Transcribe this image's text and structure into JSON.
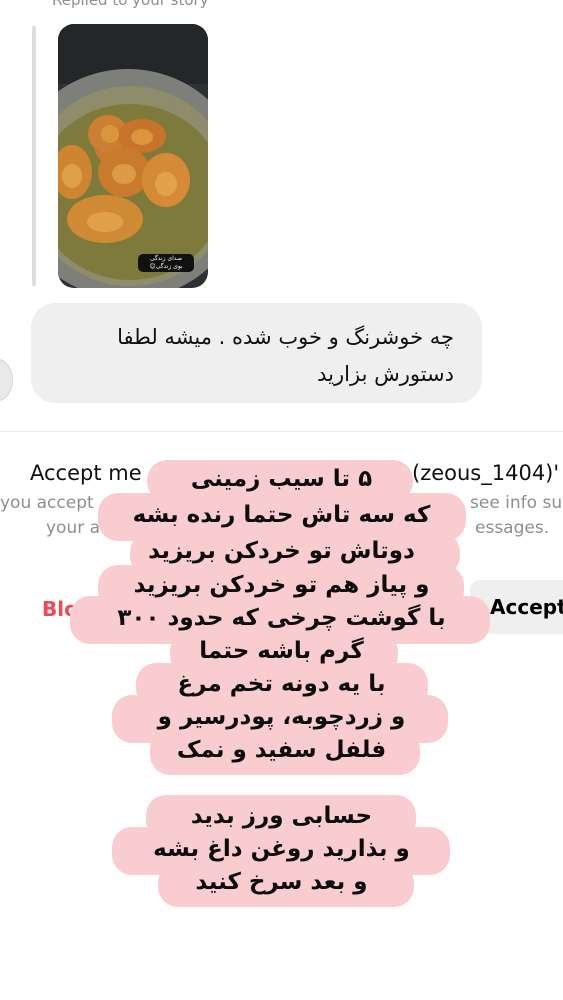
{
  "conversation": {
    "replied_label": "Replied to your story",
    "story_sticker": [
      "صدای زندگی",
      "بوی زندگی😊"
    ],
    "message": {
      "line1": "چه خوشرنگ و خوب شده . میشه لطفا",
      "line2": "دستورش بزارید"
    }
  },
  "request_panel": {
    "title_visible": "Accept me",
    "handle_visible": "(zeous_1404)'",
    "info_left_line1": "you accept",
    "info_left_line2": "your a",
    "info_right_line1": "see info su",
    "info_right_line2": "essages.",
    "block_label": "Blo",
    "accept_label": "Accept"
  },
  "recipe_overlay": {
    "colors": {
      "pill": "#f9cdd0",
      "text": "#0d0d0d"
    },
    "lines": [
      "۵ تا سیب زمینی",
      "که سه تاش حتما رنده بشه",
      "دوتاش تو خردکن بریزید",
      "و پیاز هم تو خردکن بریزید",
      "با گوشت چرخی که حدود ۳۰۰",
      "گرم باشه حتما",
      "با یه دونه تخم مرغ",
      "و زردچوبه، پودرسیر و",
      "فلفل سفید و نمک",
      "حسابی ورز بدید",
      "و بذارید روغن داغ بشه",
      "و بعد سرخ کنید"
    ]
  }
}
